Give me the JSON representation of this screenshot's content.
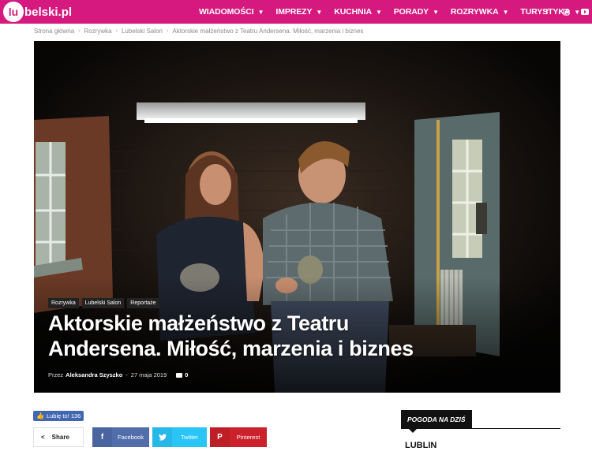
{
  "site": {
    "logo_mark": "lu",
    "logo_rest": "belski.pl"
  },
  "nav": {
    "items": [
      {
        "label": "WIADOMOŚCI"
      },
      {
        "label": "IMPREZY"
      },
      {
        "label": "KUCHNIA"
      },
      {
        "label": "PORADY"
      },
      {
        "label": "ROZRYWKA"
      },
      {
        "label": "TURYSTYKA"
      }
    ],
    "social": [
      "f",
      "instagram",
      "youtube"
    ]
  },
  "breadcrumb": [
    "Strona główna",
    "Rozrywka",
    "Lubelski Salon",
    "Aktorskie małżeństwo z Teatru Andersena. Miłość, marzenia i biznes"
  ],
  "article": {
    "tags": [
      "Rozrywka",
      "Lubelski Salon",
      "Reportaże"
    ],
    "title": "Aktorskie małżeństwo z Teatru Andersena. Miłość, marzenia i biznes",
    "by_label": "Przez",
    "author": "Aleksandra Szyszko",
    "date": "27 maja 2019",
    "comments": "0"
  },
  "social_share": {
    "like_label": "Lubię to! 136",
    "share_label": "Share",
    "facebook": "Facebook",
    "twitter": "Twitter",
    "pinterest": "Pinterest"
  },
  "weather": {
    "title": "POGODA NA DZIŚ",
    "city": "LUBLIN"
  },
  "colors": {
    "brand": "#d6197e",
    "facebook": "#516eab",
    "twitter": "#29c5f6",
    "pinterest": "#ca212a"
  }
}
